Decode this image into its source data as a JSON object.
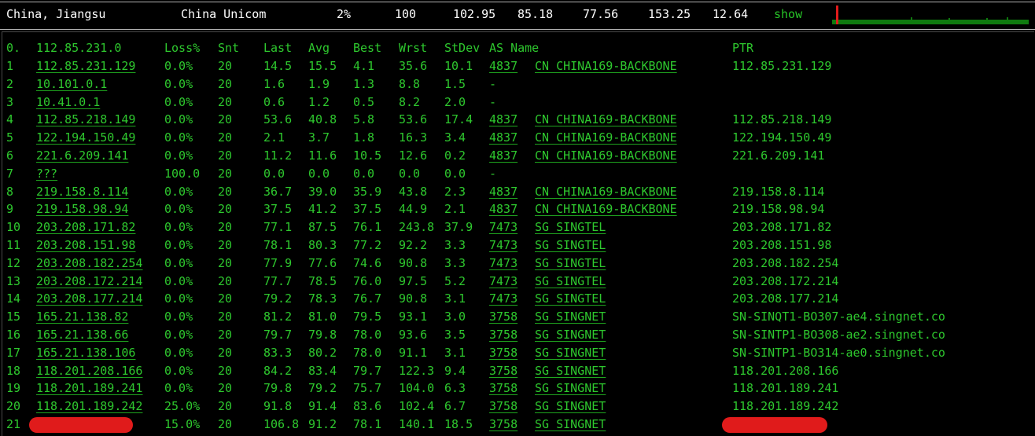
{
  "summary": {
    "location": "China, Jiangsu",
    "isp": "China Unicom",
    "loss": "2%",
    "sent": "100",
    "last": "102.95",
    "avg": "85.18",
    "best": "77.56",
    "worst": "153.25",
    "stdev": "12.64",
    "show_label": "show"
  },
  "header": {
    "hop": "0.",
    "target": "112.85.231.0",
    "loss": "Loss%",
    "snt": "Snt",
    "last": "Last",
    "avg": "Avg",
    "best": "Best",
    "wrst": "Wrst",
    "stdev": "StDev",
    "as_name": "AS Name",
    "ptr": "PTR"
  },
  "hops": [
    {
      "hop": "1",
      "ip": "112.85.231.129",
      "loss": "0.0%",
      "snt": "20",
      "last": "14.5",
      "avg": "15.5",
      "best": "4.1",
      "wrst": "35.6",
      "stdev": "10.1",
      "asn": "4837",
      "as_name": "CN CHINA169-BACKBONE",
      "ptr": "112.85.231.129"
    },
    {
      "hop": "2",
      "ip": "10.101.0.1",
      "loss": "0.0%",
      "snt": "20",
      "last": "1.6",
      "avg": "1.9",
      "best": "1.3",
      "wrst": "8.8",
      "stdev": "1.5",
      "asn": "-",
      "as_name": "",
      "ptr": ""
    },
    {
      "hop": "3",
      "ip": "10.41.0.1",
      "loss": "0.0%",
      "snt": "20",
      "last": "0.6",
      "avg": "1.2",
      "best": "0.5",
      "wrst": "8.2",
      "stdev": "2.0",
      "asn": "-",
      "as_name": "",
      "ptr": ""
    },
    {
      "hop": "4",
      "ip": "112.85.218.149",
      "loss": "0.0%",
      "snt": "20",
      "last": "53.6",
      "avg": "40.8",
      "best": "5.8",
      "wrst": "53.6",
      "stdev": "17.4",
      "asn": "4837",
      "as_name": "CN CHINA169-BACKBONE",
      "ptr": "112.85.218.149"
    },
    {
      "hop": "5",
      "ip": "122.194.150.49",
      "loss": "0.0%",
      "snt": "20",
      "last": "2.1",
      "avg": "3.7",
      "best": "1.8",
      "wrst": "16.3",
      "stdev": "3.4",
      "asn": "4837",
      "as_name": "CN CHINA169-BACKBONE",
      "ptr": "122.194.150.49"
    },
    {
      "hop": "6",
      "ip": "221.6.209.141",
      "loss": "0.0%",
      "snt": "20",
      "last": "11.2",
      "avg": "11.6",
      "best": "10.5",
      "wrst": "12.6",
      "stdev": "0.2",
      "asn": "4837",
      "as_name": "CN CHINA169-BACKBONE",
      "ptr": "221.6.209.141"
    },
    {
      "hop": "7",
      "ip": "???",
      "loss": "100.0",
      "snt": "20",
      "last": "0.0",
      "avg": "0.0",
      "best": "0.0",
      "wrst": "0.0",
      "stdev": "0.0",
      "asn": "-",
      "as_name": "",
      "ptr": ""
    },
    {
      "hop": "8",
      "ip": "219.158.8.114",
      "loss": "0.0%",
      "snt": "20",
      "last": "36.7",
      "avg": "39.0",
      "best": "35.9",
      "wrst": "43.8",
      "stdev": "2.3",
      "asn": "4837",
      "as_name": "CN CHINA169-BACKBONE",
      "ptr": "219.158.8.114"
    },
    {
      "hop": "9",
      "ip": "219.158.98.94",
      "loss": "0.0%",
      "snt": "20",
      "last": "37.5",
      "avg": "41.2",
      "best": "37.5",
      "wrst": "44.9",
      "stdev": "2.1",
      "asn": "4837",
      "as_name": "CN CHINA169-BACKBONE",
      "ptr": "219.158.98.94"
    },
    {
      "hop": "10",
      "ip": "203.208.171.82",
      "loss": "0.0%",
      "snt": "20",
      "last": "77.1",
      "avg": "87.5",
      "best": "76.1",
      "wrst": "243.8",
      "stdev": "37.9",
      "asn": "7473",
      "as_name": "SG SINGTEL",
      "ptr": "203.208.171.82"
    },
    {
      "hop": "11",
      "ip": "203.208.151.98",
      "loss": "0.0%",
      "snt": "20",
      "last": "78.1",
      "avg": "80.3",
      "best": "77.2",
      "wrst": "92.2",
      "stdev": "3.3",
      "asn": "7473",
      "as_name": "SG SINGTEL",
      "ptr": "203.208.151.98"
    },
    {
      "hop": "12",
      "ip": "203.208.182.254",
      "loss": "0.0%",
      "snt": "20",
      "last": "77.9",
      "avg": "77.6",
      "best": "74.6",
      "wrst": "90.8",
      "stdev": "3.3",
      "asn": "7473",
      "as_name": "SG SINGTEL",
      "ptr": "203.208.182.254"
    },
    {
      "hop": "13",
      "ip": "203.208.172.214",
      "loss": "0.0%",
      "snt": "20",
      "last": "77.7",
      "avg": "78.5",
      "best": "76.0",
      "wrst": "97.5",
      "stdev": "5.2",
      "asn": "7473",
      "as_name": "SG SINGTEL",
      "ptr": "203.208.172.214"
    },
    {
      "hop": "14",
      "ip": "203.208.177.214",
      "loss": "0.0%",
      "snt": "20",
      "last": "79.2",
      "avg": "78.3",
      "best": "76.7",
      "wrst": "90.8",
      "stdev": "3.1",
      "asn": "7473",
      "as_name": "SG SINGTEL",
      "ptr": "203.208.177.214"
    },
    {
      "hop": "15",
      "ip": "165.21.138.82",
      "loss": "0.0%",
      "snt": "20",
      "last": "81.2",
      "avg": "81.0",
      "best": "79.5",
      "wrst": "93.1",
      "stdev": "3.0",
      "asn": "3758",
      "as_name": "SG SINGNET",
      "ptr": "SN-SINQT1-BO307-ae4.singnet.co"
    },
    {
      "hop": "16",
      "ip": "165.21.138.66",
      "loss": "0.0%",
      "snt": "20",
      "last": "79.7",
      "avg": "79.8",
      "best": "78.0",
      "wrst": "93.6",
      "stdev": "3.5",
      "asn": "3758",
      "as_name": "SG SINGNET",
      "ptr": "SN-SINTP1-BO308-ae2.singnet.co"
    },
    {
      "hop": "17",
      "ip": "165.21.138.106",
      "loss": "0.0%",
      "snt": "20",
      "last": "83.3",
      "avg": "80.2",
      "best": "78.0",
      "wrst": "91.1",
      "stdev": "3.1",
      "asn": "3758",
      "as_name": "SG SINGNET",
      "ptr": "SN-SINTP1-BO314-ae0.singnet.co"
    },
    {
      "hop": "18",
      "ip": "118.201.208.166",
      "loss": "0.0%",
      "snt": "20",
      "last": "84.2",
      "avg": "83.4",
      "best": "79.7",
      "wrst": "122.3",
      "stdev": "9.4",
      "asn": "3758",
      "as_name": "SG SINGNET",
      "ptr": "118.201.208.166"
    },
    {
      "hop": "19",
      "ip": "118.201.189.241",
      "loss": "0.0%",
      "snt": "20",
      "last": "79.8",
      "avg": "79.2",
      "best": "75.7",
      "wrst": "104.0",
      "stdev": "6.3",
      "asn": "3758",
      "as_name": "SG SINGNET",
      "ptr": "118.201.189.241"
    },
    {
      "hop": "20",
      "ip": "118.201.189.242",
      "loss": "25.0%",
      "snt": "20",
      "last": "91.8",
      "avg": "91.4",
      "best": "83.6",
      "wrst": "102.4",
      "stdev": "6.7",
      "asn": "3758",
      "as_name": "SG SINGNET",
      "ptr": "118.201.189.242"
    },
    {
      "hop": "21",
      "ip": "",
      "loss": "15.0%",
      "snt": "20",
      "last": "106.8",
      "avg": "91.2",
      "best": "78.1",
      "wrst": "140.1",
      "stdev": "18.5",
      "asn": "3758",
      "as_name": "SG SINGNET",
      "ptr": ""
    }
  ],
  "colors": {
    "text_green": "#2ec82e",
    "redaction": "#e01b1b",
    "background": "#000000"
  }
}
